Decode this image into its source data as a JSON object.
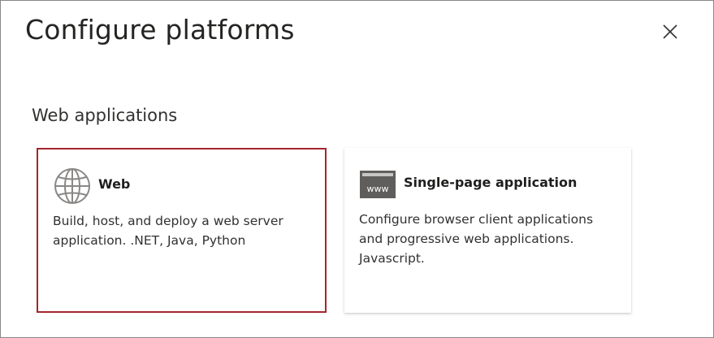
{
  "dialog": {
    "title": "Configure platforms",
    "close_icon": "close-icon"
  },
  "section": {
    "title": "Web applications"
  },
  "cards": [
    {
      "title": "Web",
      "icon": "globe-icon",
      "description_lines": [
        "Build, host, and deploy a web server",
        "application. .NET, Java, Python"
      ],
      "selected": true
    },
    {
      "title": "Single-page application",
      "icon": "www-browser-icon",
      "icon_text": "www",
      "description_lines": [
        "Configure browser client applications",
        "and progressive web applications.",
        "Javascript."
      ],
      "selected": false
    }
  ],
  "colors": {
    "selected_border": "#a4262c",
    "text_primary": "#201f1e",
    "icon_gray": "#8a8886",
    "icon_dark": "#605e5c"
  }
}
